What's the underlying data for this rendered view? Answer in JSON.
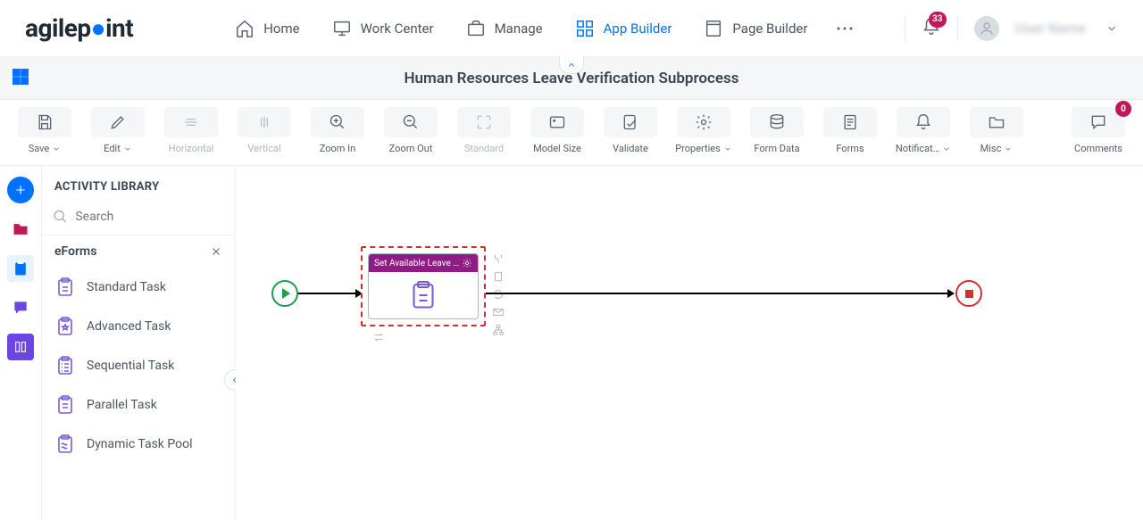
{
  "header": {
    "logo_pre": "agilep",
    "logo_post": "int",
    "nav": [
      {
        "label": "Home"
      },
      {
        "label": "Work Center"
      },
      {
        "label": "Manage"
      },
      {
        "label": "App Builder"
      },
      {
        "label": "Page Builder"
      }
    ],
    "notifications_count": "33",
    "user_name": "User Name"
  },
  "subheader": {
    "title": "Human Resources Leave Verification Subprocess"
  },
  "toolbar": {
    "save": "Save",
    "edit": "Edit",
    "horizontal": "Horizontal",
    "vertical": "Vertical",
    "zoom_in": "Zoom In",
    "zoom_out": "Zoom Out",
    "standard": "Standard",
    "model_size": "Model Size",
    "validate": "Validate",
    "properties": "Properties",
    "form_data": "Form Data",
    "forms": "Forms",
    "notifications": "Notificat…",
    "misc": "Misc",
    "comments": "Comments",
    "comments_count": "0"
  },
  "sidebar": {
    "title": "ACTIVITY LIBRARY",
    "search_placeholder": "Search",
    "category": "eForms",
    "items": [
      {
        "label": "Standard Task"
      },
      {
        "label": "Advanced Task"
      },
      {
        "label": "Sequential Task"
      },
      {
        "label": "Parallel Task"
      },
      {
        "label": "Dynamic Task Pool"
      }
    ]
  },
  "canvas": {
    "activity": {
      "title": "Set Available Leave …"
    }
  }
}
